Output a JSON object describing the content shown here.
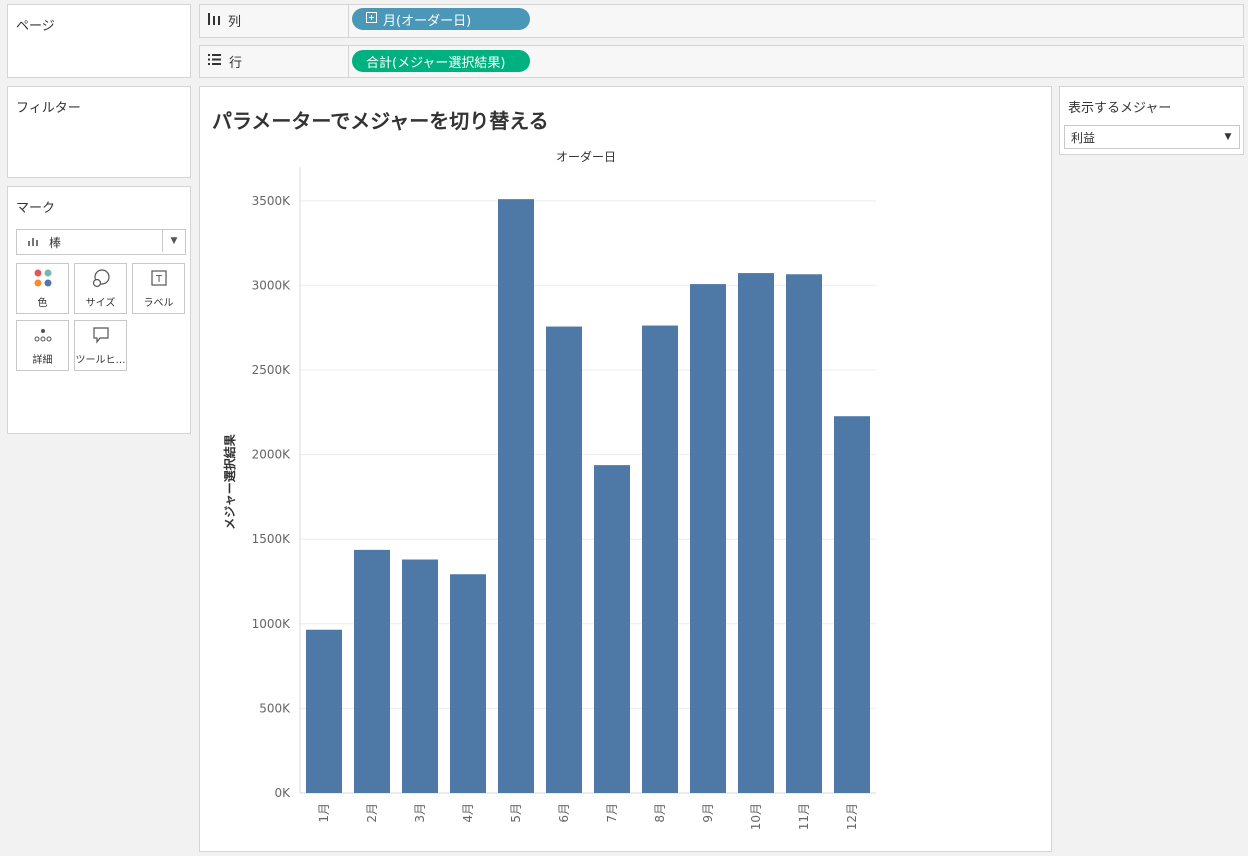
{
  "shelves": {
    "pages_label": "ページ",
    "filters_label": "フィルター",
    "marks_label": "マーク",
    "columns_label": "列",
    "rows_label": "行",
    "columns_pill": "月(オーダー日)",
    "rows_pill": "合計(メジャー選択結果)"
  },
  "marks": {
    "type": "棒",
    "buttons": {
      "color": "色",
      "size": "サイズ",
      "label": "ラベル",
      "detail": "詳細",
      "tooltip": "ツールヒ…"
    }
  },
  "parameter": {
    "title": "表示するメジャー",
    "value": "利益"
  },
  "worksheet": {
    "title": "パラメーターでメジャーを切り替える"
  },
  "colors": {
    "bar": "#4e79a7",
    "pill_blue": "#4a97b7",
    "pill_green": "#00b180"
  },
  "chart_data": {
    "type": "bar",
    "header": "オーダー日",
    "ylabel": "メジャー選択結果",
    "categories": [
      "1月",
      "2月",
      "3月",
      "4月",
      "5月",
      "6月",
      "7月",
      "8月",
      "9月",
      "10月",
      "11月",
      "12月"
    ],
    "values": [
      965,
      1437,
      1380,
      1293,
      3510,
      2757,
      1938,
      2763,
      3008,
      3073,
      3066,
      2227
    ],
    "value_unit": "K",
    "ylim": [
      0,
      3700
    ],
    "yticks": [
      0,
      500,
      1000,
      1500,
      2000,
      2500,
      3000,
      3500
    ],
    "ytick_labels": [
      "0K",
      "500K",
      "1000K",
      "1500K",
      "2000K",
      "2500K",
      "3000K",
      "3500K"
    ],
    "grid": true
  }
}
